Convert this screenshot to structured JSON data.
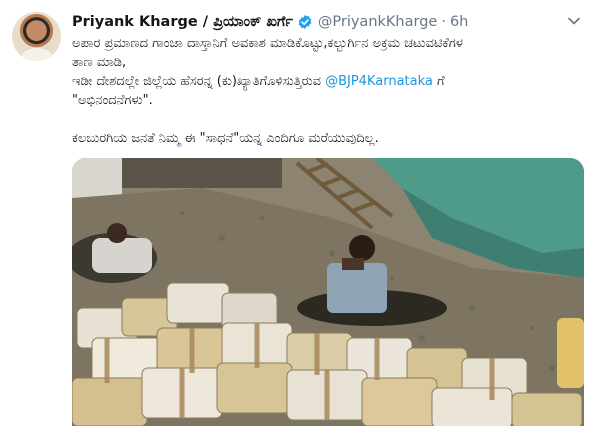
{
  "author": {
    "name": "Priyank Kharge / ಪ್ರಿಯಾಂಕ್ ಖರ್ಗೆ",
    "handle": "@PriyankKharge",
    "separator": "·",
    "time": "6h",
    "verified": true
  },
  "tweet": {
    "line1": "ಅಪಾರ ಪ್ರಮಾಣದ ಗಾಂಜಾ ದಾಸ್ತಾನಿಗೆ ಅವಕಾಶ ಮಾಡಿಕೊಟ್ಟು,ಕಲ್ಬುರ್ಗಿನ ಅಕ್ರಮ ಚಟುವಟಿಕೆಗಳ",
    "line2": "ತಾಣ ಮಾಡಿ,",
    "line3_before": "ಇಡೀ ದೇಶದಲ್ಲೇ ಜಿಲ್ಲೆಯ ಹೆಸರನ್ನ (ಕು)ಖ್ಯಾತಿಗೊಳಿಸುತ್ತಿರುವ ",
    "mention": "@BJP4Karnataka",
    "line3_after": " ಗೆ",
    "line4": "\"ಅಭಿನಂದನೆಗಳು\".",
    "line5": "ಕಲಬುರಗಿಯ ಜನತೆ ನಿಮ್ಮ ಈ \"ಸಾಧನೆ\"ಯನ್ನ ಎಂದಿಗೂ ಮರೆಯುವುದಿಲ್ಲ."
  },
  "icons": {
    "verified": "verified-badge-icon",
    "menu": "chevron-down-icon"
  },
  "colors": {
    "accent": "#1da1f2",
    "mention": "#1b95e0",
    "secondary_text": "#657786"
  }
}
